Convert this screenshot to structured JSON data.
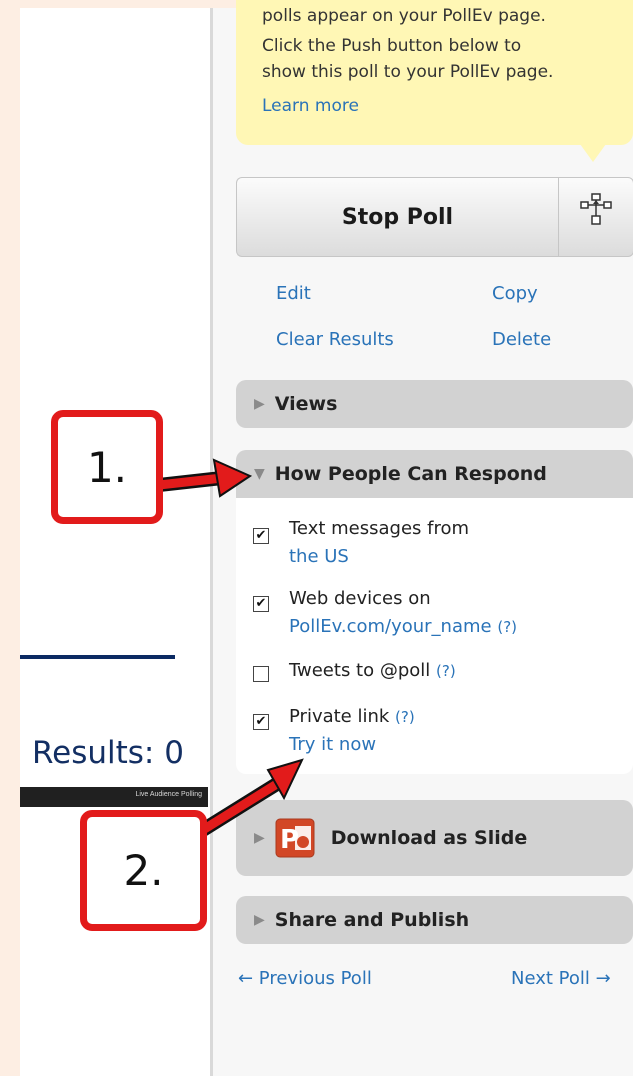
{
  "tip": {
    "lines": [
      "polls appear on your PollEv page.",
      "Click the Push button below to",
      "show this poll to your PollEv page."
    ],
    "learn_more": "Learn more"
  },
  "poll_controls": {
    "stop_poll_label": "Stop Poll",
    "push_icon": "network-push-icon"
  },
  "actions": {
    "edit": "Edit",
    "copy": "Copy",
    "clear_results": "Clear Results",
    "delete": "Delete"
  },
  "sections": {
    "views": "Views",
    "how_people_can_respond": "How People Can Respond",
    "download_as_slide": "Download as Slide",
    "share_and_publish": "Share and Publish"
  },
  "response_options": [
    {
      "label": "Text messages from",
      "sub": "the US",
      "checked": true,
      "help": ""
    },
    {
      "label": "Web devices on",
      "sub": "PollEv.com/your_name",
      "checked": true,
      "help": "(?)"
    },
    {
      "label": "Tweets to @poll",
      "sub": "",
      "checked": false,
      "help": "(?)"
    },
    {
      "label": "Private link",
      "sub": "Try it now",
      "checked": true,
      "help": "(?)"
    }
  ],
  "nav": {
    "previous": "← Previous Poll",
    "next": "Next Poll →"
  },
  "slide_preview": {
    "results": "Results: 0",
    "footer": "Live Audience Polling"
  },
  "callouts": [
    "1.",
    "2."
  ],
  "colors": {
    "link": "#2a73b8",
    "callout_red": "#e21b1b",
    "tip_background": "#fff7b5",
    "section_bar": "#d2d2d2"
  }
}
